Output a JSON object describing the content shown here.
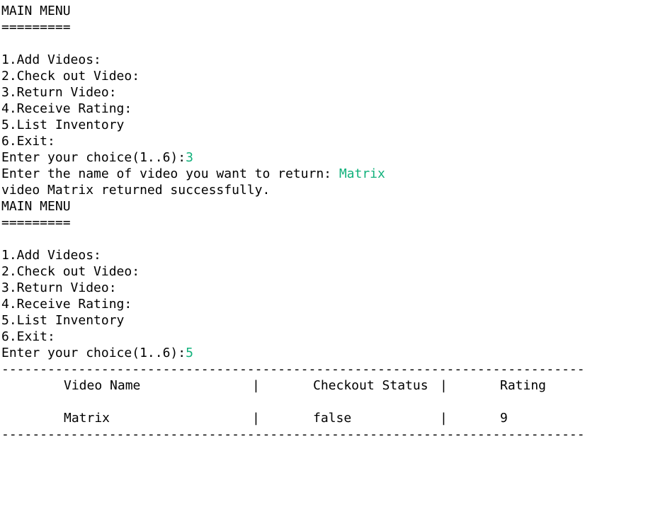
{
  "session1": {
    "menu_title": "MAIN MENU",
    "underline": "=========",
    "items": [
      "1.Add Videos:",
      "2.Check out Video:",
      "3.Return Video:",
      "4.Receive Rating:",
      "5.List Inventory",
      "6.Exit:"
    ],
    "prompt": "Enter your choice(1..6):",
    "choice": "3",
    "return_prompt": "Enter the name of video you want to return: ",
    "return_input": "Matrix",
    "result": "video Matrix returned successfully."
  },
  "session2": {
    "menu_title": "MAIN MENU",
    "underline": "=========",
    "items": [
      "1.Add Videos:",
      "2.Check out Video:",
      "3.Return Video:",
      "4.Receive Rating:",
      "5.List Inventory",
      "6.Exit:"
    ],
    "prompt": "Enter your choice(1..6):",
    "choice": "5"
  },
  "table": {
    "rule": "----------------------------------------------------------------------------",
    "separator": "|",
    "headers": [
      "Video Name",
      "Checkout Status",
      "Rating"
    ],
    "rows": [
      [
        "Matrix",
        "false",
        "9"
      ]
    ]
  },
  "colors": {
    "input": "#11b17b",
    "text": "#000000",
    "background": "#ffffff"
  }
}
